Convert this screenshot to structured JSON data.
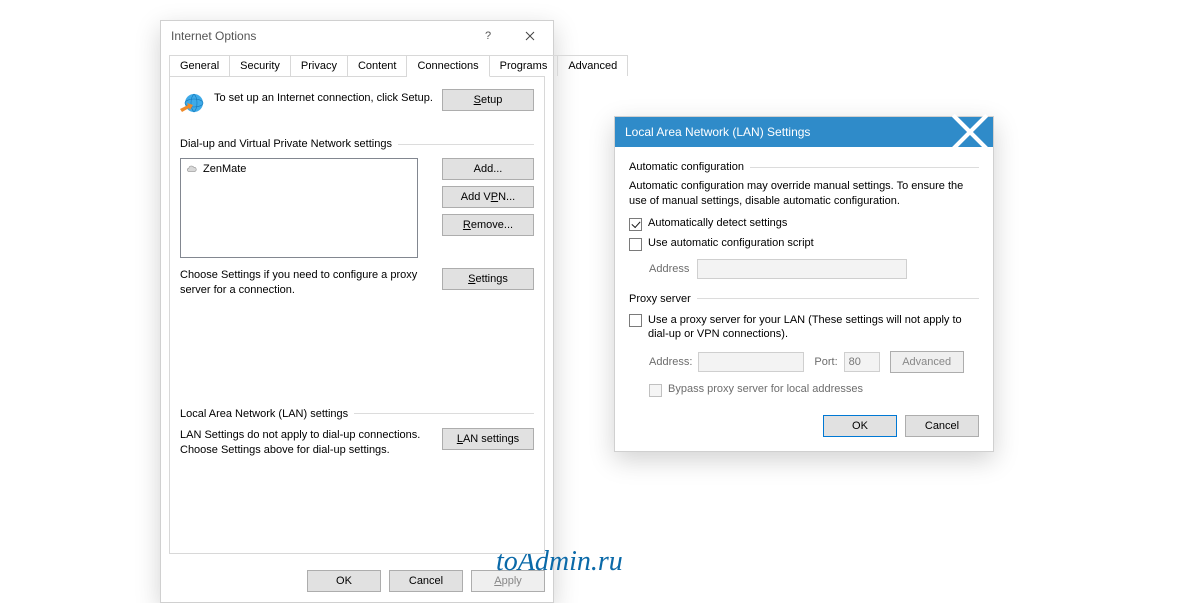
{
  "internet_options": {
    "title": "Internet Options",
    "help_label": "?",
    "tabs": [
      "General",
      "Security",
      "Privacy",
      "Content",
      "Connections",
      "Programs",
      "Advanced"
    ],
    "active_tab": "Connections",
    "setup_hint": "To set up an Internet connection, click Setup.",
    "setup_button": "Setup",
    "dialup_group": "Dial-up and Virtual Private Network settings",
    "dialup_items": [
      "ZenMate"
    ],
    "add_button": "Add...",
    "add_vpn_button": "Add VPN...",
    "remove_button": "Remove...",
    "settings_button": "Settings",
    "dialup_hint": "Choose Settings if you need to configure a proxy server for a connection.",
    "lan_group": "Local Area Network (LAN) settings",
    "lan_hint": "LAN Settings do not apply to dial-up connections. Choose Settings above for dial-up settings.",
    "lan_button": "LAN settings",
    "ok": "OK",
    "cancel": "Cancel",
    "apply": "Apply"
  },
  "lan_settings": {
    "title": "Local Area Network (LAN) Settings",
    "auto_group": "Automatic configuration",
    "auto_hint": "Automatic configuration may override manual settings.  To ensure the use of manual settings, disable automatic configuration.",
    "auto_detect": "Automatically detect settings",
    "auto_script": "Use automatic configuration script",
    "address_label": "Address",
    "address_value": "",
    "proxy_group": "Proxy server",
    "proxy_use": "Use a proxy server for your LAN (These settings will not apply to dial-up or VPN connections).",
    "proxy_address_label": "Address:",
    "proxy_address_value": "",
    "proxy_port_label": "Port:",
    "proxy_port_value": "80",
    "proxy_advanced": "Advanced",
    "proxy_bypass": "Bypass proxy server for local addresses",
    "ok": "OK",
    "cancel": "Cancel"
  },
  "watermark": "toAdmin.ru"
}
